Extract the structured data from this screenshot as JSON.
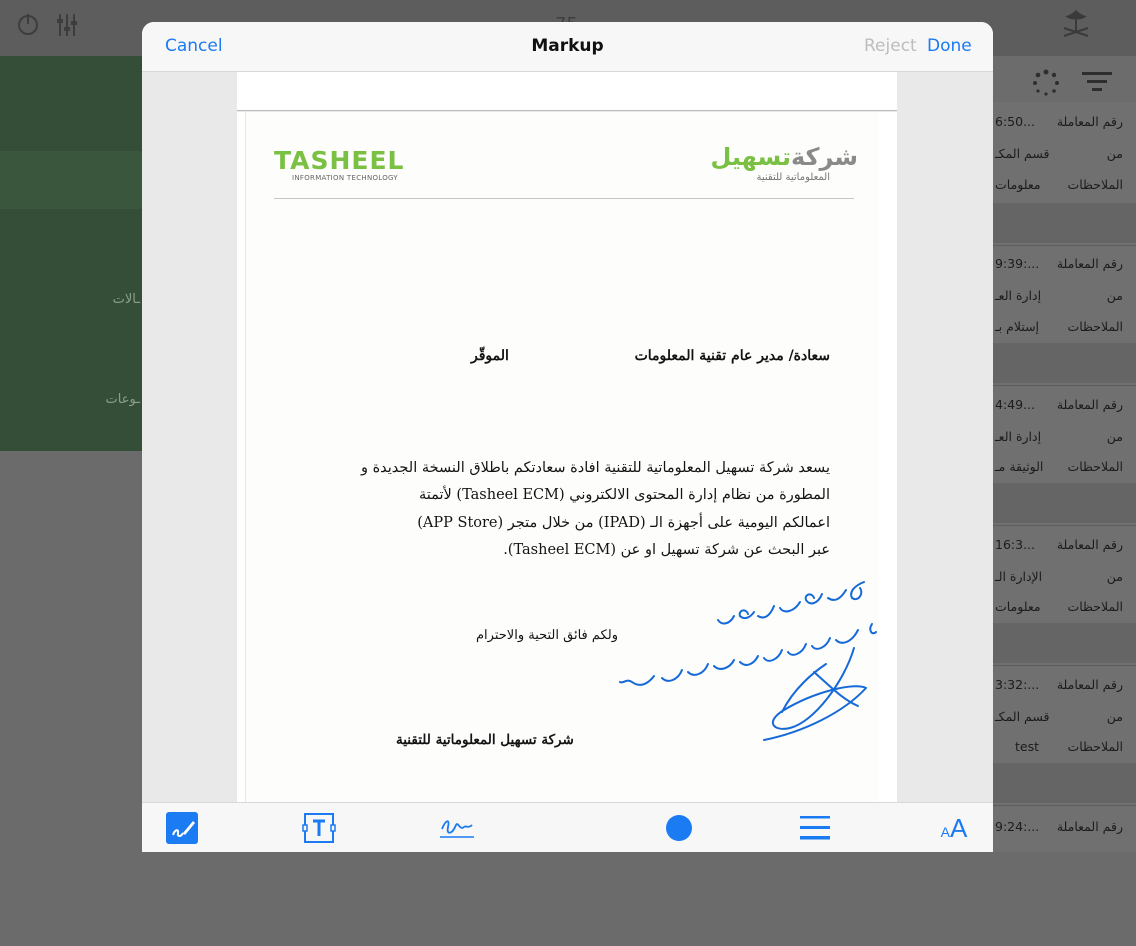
{
  "background": {
    "title": "ــــــ 75",
    "left_labels": [
      "ـالات",
      "ـوعات"
    ],
    "rows": [
      {
        "time": "6:50...",
        "k1": "رقم المعاملة",
        "from": "قسم المكـ",
        "k2": "من",
        "notes": "معلومات",
        "k3": "الملاحظات"
      },
      {
        "time": "9:39:...",
        "k1": "رقم المعاملة",
        "from": "إدارة العـ",
        "k2": "من",
        "notes": "إستلام بـ",
        "k3": "الملاحظات"
      },
      {
        "time": "4:49...",
        "k1": "رقم المعاملة",
        "from": "إدارة العـ",
        "k2": "من",
        "notes": "الوثيقة مـ",
        "k3": "الملاحظات"
      },
      {
        "time": "16:3...",
        "k1": "رقم المعاملة",
        "from": "الإدارة الـ",
        "k2": "من",
        "notes": "معلومات",
        "k3": "الملاحظات"
      },
      {
        "time": "3:32:...",
        "k1": "رقم المعاملة",
        "from": "قسم المكـ",
        "k2": "من",
        "notes": "test",
        "k3": "الملاحظات"
      },
      {
        "time": "9:24:...",
        "k1": "رقم المعاملة"
      }
    ]
  },
  "navbar": {
    "cancel": "Cancel",
    "title": "Markup",
    "reject": "Reject",
    "done": "Done"
  },
  "letter": {
    "logo_en": {
      "name_part1": "TAS",
      "name_part2": "HEEL",
      "sub": "INFORMATION TECHNOLOGY"
    },
    "logo_ar": {
      "name_part1": "شركة",
      "name_part2": "تسهيل",
      "sub": "المعلوماتية للتقنية"
    },
    "salutation": "سعادة/ مدير عام تقنية المعلومات",
    "salutation_honor": "الموقّر",
    "body_lines": [
      "يسعد شركة تسهيل المعلوماتية للتقنية افادة سعادتكم باطلاق النسخة الجديدة و",
      "المطورة من نظام إدارة المحتوى الالكتروني (Tasheel ECM) لأتمتة",
      "اعمالكم اليومية على أجهزة الـ (IPAD) من خلال متجر (APP Store)",
      "عبر البحث عن شركة تسهيل او عن (Tasheel ECM)."
    ],
    "closing": "ولكم فائق التحية والاحترام",
    "signature": "شركة تسهيل المعلوماتية للتقنية",
    "ink_color": "#1669d8"
  },
  "colors": {
    "accent": "#1a7bf2",
    "brand_green": "#7ac043"
  },
  "toolbar": {
    "tools": [
      "sketch-icon",
      "text-box-icon",
      "signature-icon",
      "color-dot-icon",
      "line-width-icon",
      "font-size-icon"
    ],
    "font_glyph_small": "A",
    "font_glyph_large": "A"
  }
}
